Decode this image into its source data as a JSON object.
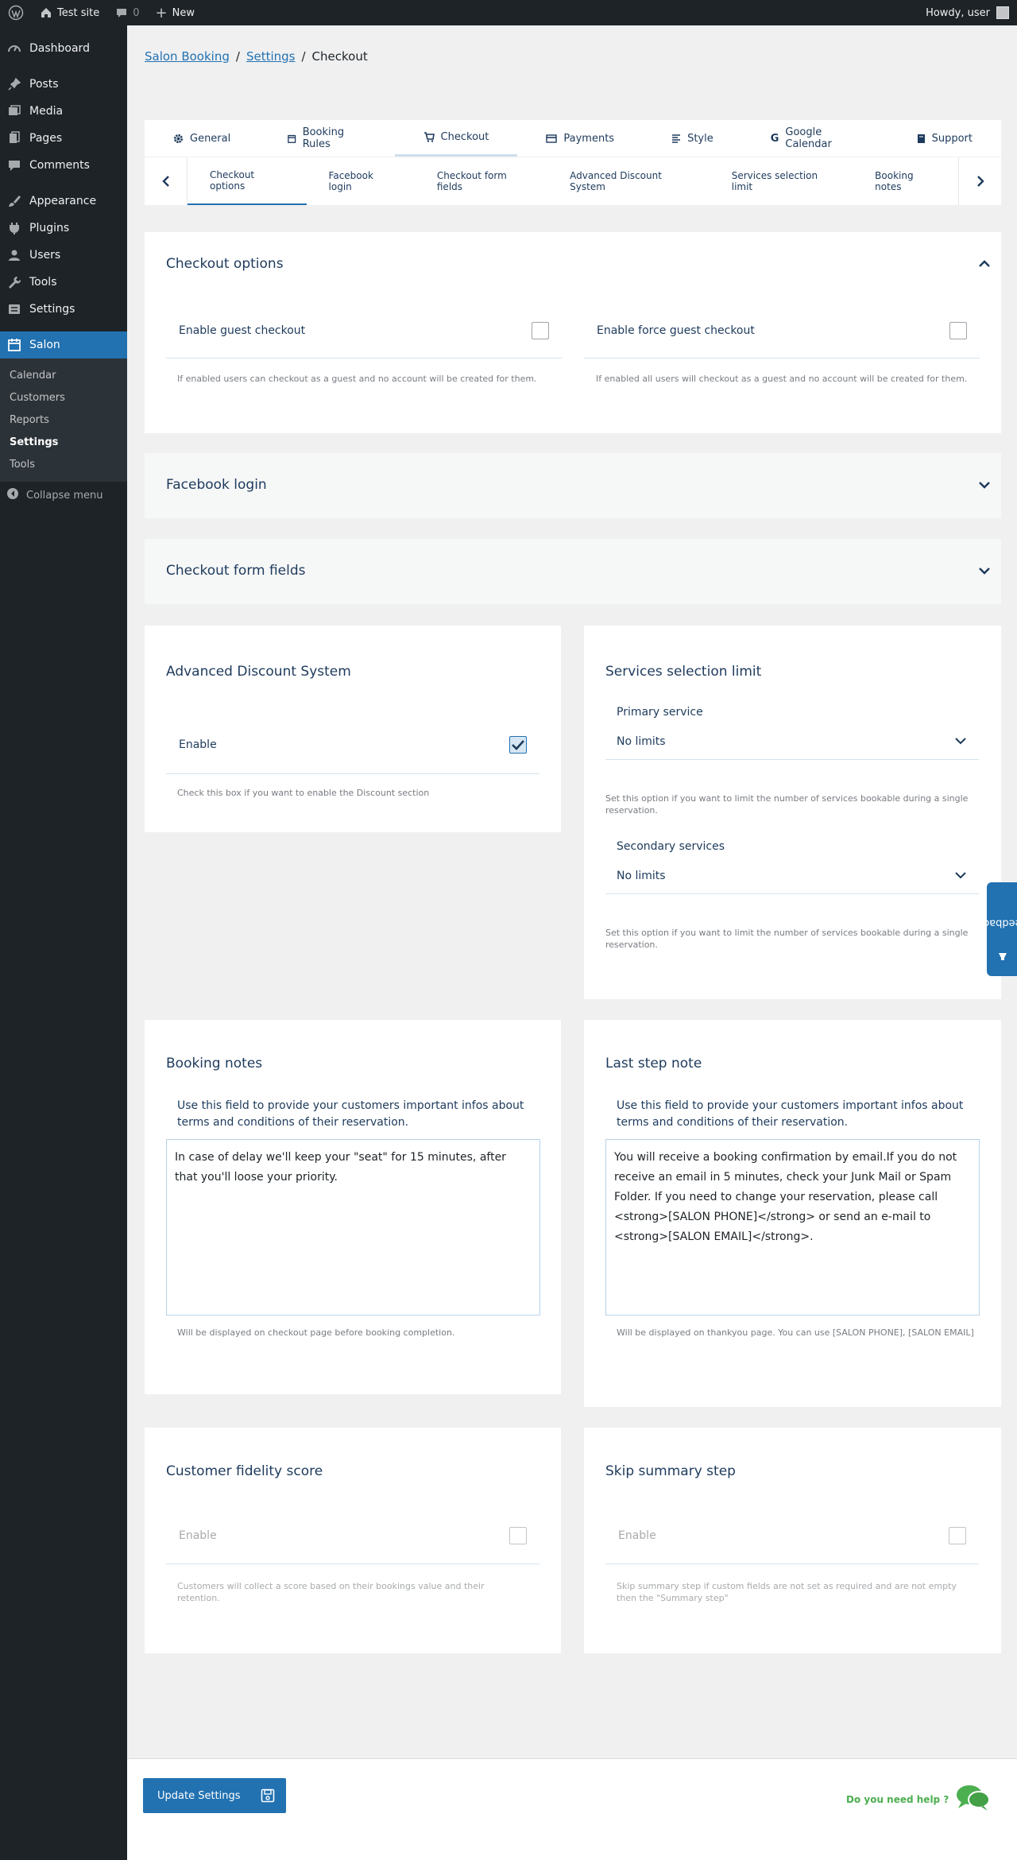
{
  "adminbar": {
    "site_name": "Test site",
    "comments_count": "0",
    "new_label": "New",
    "howdy": "Howdy, user"
  },
  "sidebar": {
    "items": [
      {
        "label": "Dashboard",
        "icon": "dashboard-icon"
      },
      {
        "label": "Posts",
        "icon": "pin-icon"
      },
      {
        "label": "Media",
        "icon": "media-icon"
      },
      {
        "label": "Pages",
        "icon": "page-icon"
      },
      {
        "label": "Comments",
        "icon": "comment-icon"
      },
      {
        "label": "Appearance",
        "icon": "brush-icon"
      },
      {
        "label": "Plugins",
        "icon": "plug-icon"
      },
      {
        "label": "Users",
        "icon": "user-icon"
      },
      {
        "label": "Tools",
        "icon": "wrench-icon"
      },
      {
        "label": "Settings",
        "icon": "settings-icon"
      }
    ],
    "current": {
      "label": "Salon",
      "icon": "calendar-icon"
    },
    "submenu": [
      "Calendar",
      "Customers",
      "Reports",
      "Settings",
      "Tools"
    ],
    "collapse": "Collapse menu"
  },
  "breadcrumb": {
    "root": "Salon Booking",
    "parent": "Settings",
    "current": "Checkout"
  },
  "tabs": [
    {
      "label": "General",
      "icon": "gear-icon"
    },
    {
      "label": "Booking Rules",
      "icon": "calendar-icon"
    },
    {
      "label": "Checkout",
      "icon": "cart-icon"
    },
    {
      "label": "Payments",
      "icon": "credit-card-icon"
    },
    {
      "label": "Style",
      "icon": "align-icon"
    },
    {
      "label": "Google Calendar",
      "icon": "google-icon"
    },
    {
      "label": "Support",
      "icon": "book-icon"
    }
  ],
  "subtabs": [
    "Checkout options",
    "Facebook login",
    "Checkout form fields",
    "Advanced Discount System",
    "Services selection limit",
    "Booking notes"
  ],
  "checkout_options": {
    "title": "Checkout options",
    "guest_label": "Enable guest checkout",
    "guest_help": "If enabled users can checkout as a guest and no account will be created for them.",
    "force_label": "Enable force guest checkout",
    "force_help": "If enabled all users will checkout as a guest and no account will be created for them."
  },
  "facebook": {
    "title": "Facebook login"
  },
  "form_fields": {
    "title": "Checkout form fields"
  },
  "discount": {
    "title": "Advanced Discount System",
    "enable_label": "Enable",
    "help": "Check this box if you want to enable the Discount section"
  },
  "services_limit": {
    "title": "Services selection limit",
    "primary_label": "Primary service",
    "primary_value": "No limits",
    "primary_help": "Set this option if you want to limit the number of services bookable during a single reservation.",
    "secondary_label": "Secondary services",
    "secondary_value": "No limits",
    "secondary_help": "Set this option if you want to limit the number of services bookable during a single reservation."
  },
  "booking_notes": {
    "title": "Booking notes",
    "desc": "Use this field to provide your customers important infos about terms and conditions of their reservation.",
    "value": "In case of delay we'll keep your \"seat\" for 15 minutes, after that you'll loose your priority.",
    "help": "Will be displayed on checkout page before booking completion."
  },
  "last_step": {
    "title": "Last step note",
    "desc": "Use this field to provide your customers important infos about terms and conditions of their reservation.",
    "value": "You will receive a booking confirmation by email.If you do not receive an email in 5 minutes, check your Junk Mail or Spam Folder. If you need to change your reservation, please call <strong>[SALON PHONE]</strong> or send an e-mail to <strong>[SALON EMAIL]</strong>.",
    "help": "Will be displayed on thankyou page. You can use [SALON PHONE], [SALON EMAIL]"
  },
  "fidelity": {
    "title": "Customer fidelity score",
    "enable_label": "Enable",
    "help": "Customers will collect a score based on their bookings value and their retention."
  },
  "skip_summary": {
    "title": "Skip summary step",
    "enable_label": "Enable",
    "help": "Skip summary step if custom fields are not set as required and are not empty then the \"Summary step\""
  },
  "feedback": "Feedback",
  "footer": {
    "update_label": "Update Settings",
    "help_label": "Do you need help ?"
  },
  "colors": {
    "accent": "#2271b1",
    "sidebar": "#1d2327",
    "help_green": "#4caf50"
  }
}
